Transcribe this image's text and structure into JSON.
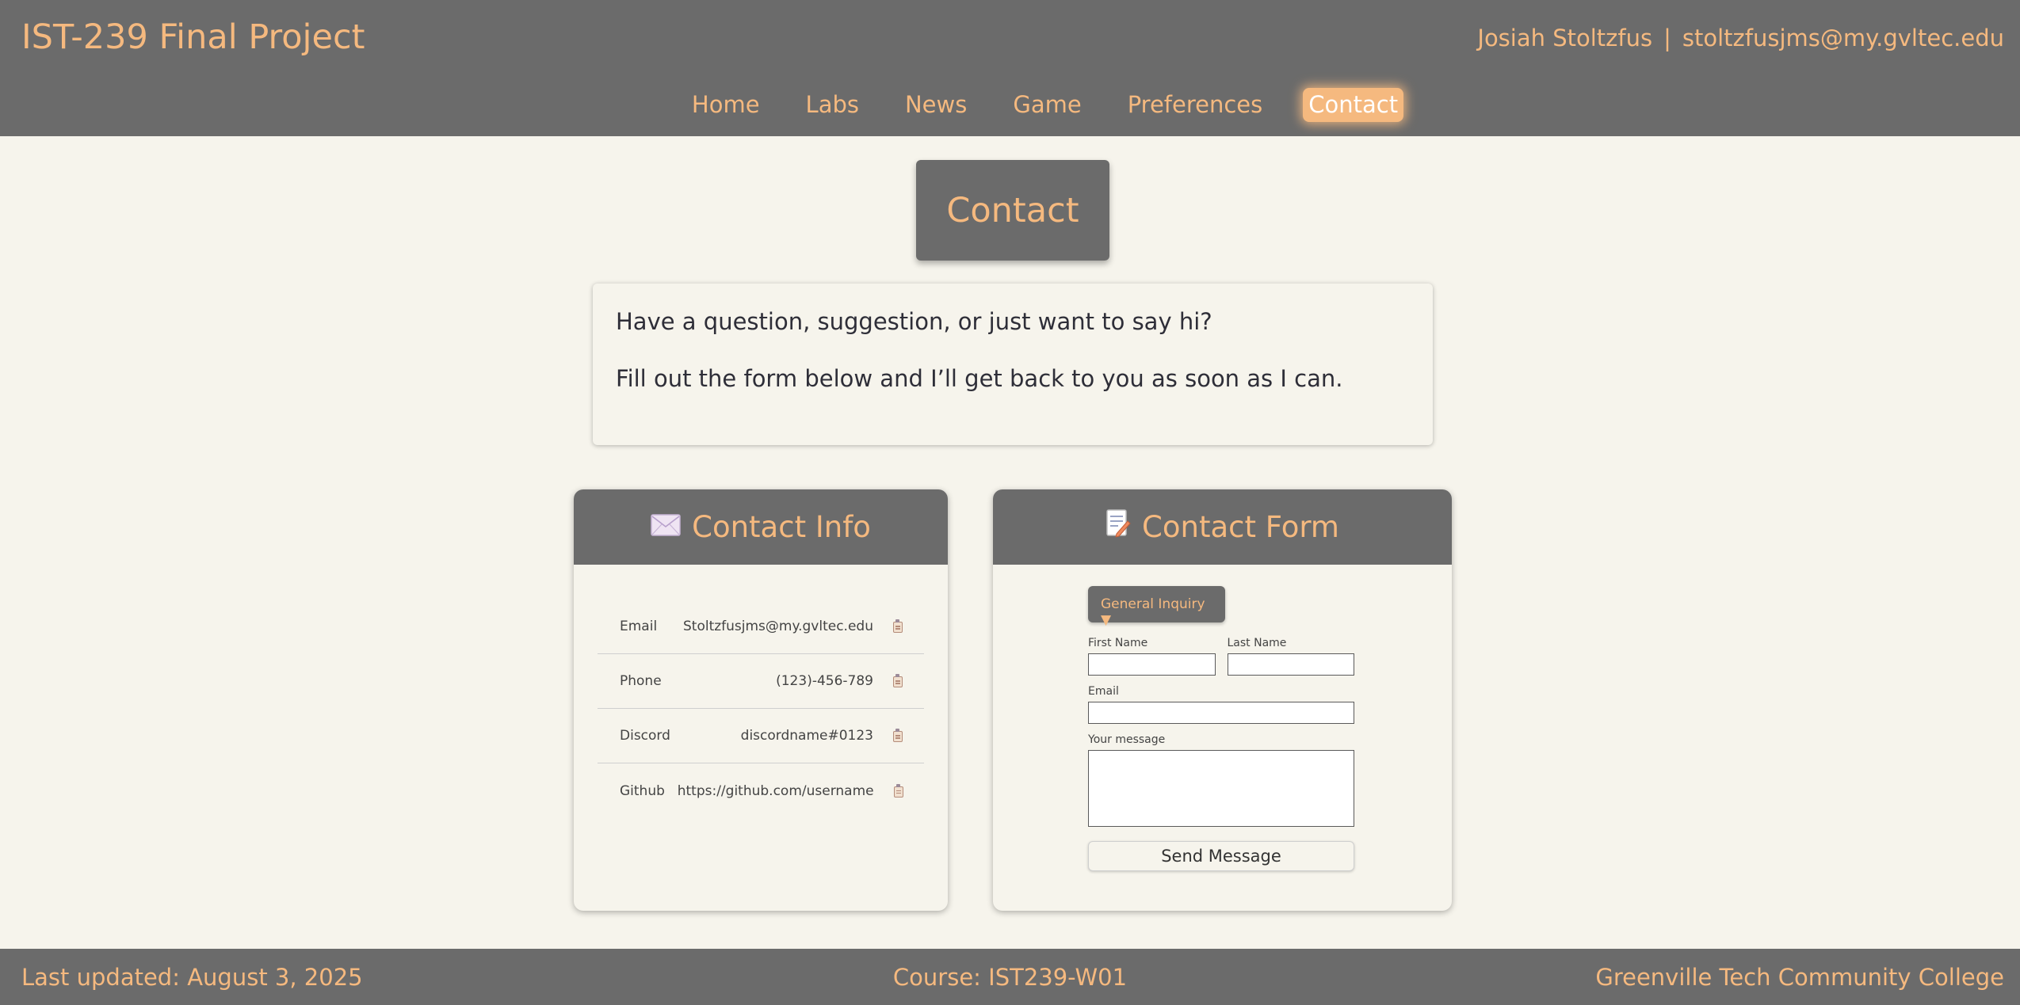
{
  "header": {
    "site_title": "IST-239 Final Project",
    "author_name": "Josiah Stoltzfus",
    "author_separator": "|",
    "author_email": "stoltzfusjms@my.gvltec.edu",
    "nav": [
      {
        "label": "Home",
        "active": false
      },
      {
        "label": "Labs",
        "active": false
      },
      {
        "label": "News",
        "active": false
      },
      {
        "label": "Game",
        "active": false
      },
      {
        "label": "Preferences",
        "active": false
      },
      {
        "label": "Contact",
        "active": true
      }
    ]
  },
  "page": {
    "title": "Contact",
    "intro_line1": "Have a question, suggestion, or just want to say hi?",
    "intro_line2": "Fill out the form below and I’ll get back to you as soon as I can."
  },
  "contact_info": {
    "icon": "envelope-icon",
    "title": "Contact Info",
    "rows": [
      {
        "label": "Email",
        "value": "Stoltzfusjms@my.gvltec.edu"
      },
      {
        "label": "Phone",
        "value": "(123)-456-789"
      },
      {
        "label": "Discord",
        "value": "discordname#0123"
      },
      {
        "label": "Github",
        "value": "https://github.com/username"
      }
    ]
  },
  "contact_form": {
    "icon": "memo-icon",
    "title": "Contact Form",
    "inquiry_type": "General Inquiry ▼",
    "first_name_label": "First Name",
    "last_name_label": "Last Name",
    "email_label": "Email",
    "message_label": "Your message",
    "first_name_value": "",
    "last_name_value": "",
    "email_value": "",
    "message_value": "",
    "send_label": "Send Message"
  },
  "footer": {
    "last_updated": "Last updated: August 3, 2025",
    "course": "Course: IST239-W01",
    "school": "Greenville Tech Community College"
  },
  "colors": {
    "accent": "#f5b97f",
    "bar": "#6b6b6b",
    "background": "#f6f4ec"
  }
}
